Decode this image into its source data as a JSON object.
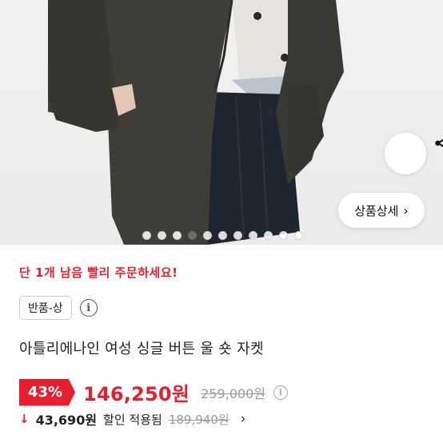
{
  "hero": {
    "share_icon": "share-icon",
    "detail_label": "상품상세",
    "dots_total": 11,
    "active_dot_index": 3
  },
  "info": {
    "urgency": "단 1개 남음 빨리 주문하세요!",
    "condition_badge": "반품-상",
    "title": "아틀리에나인 여성 싱글 버튼 울 숏 자켓",
    "discount": "43%",
    "price": "146,250원",
    "original_price": "259,000원",
    "coupon_amount": "43,690원",
    "coupon_text": "할인 적용됨",
    "coupon_price": "189,940원"
  },
  "colors": {
    "accent": "#e5202e",
    "jacket": "#3f3d37",
    "skirt": "#1f2530"
  }
}
